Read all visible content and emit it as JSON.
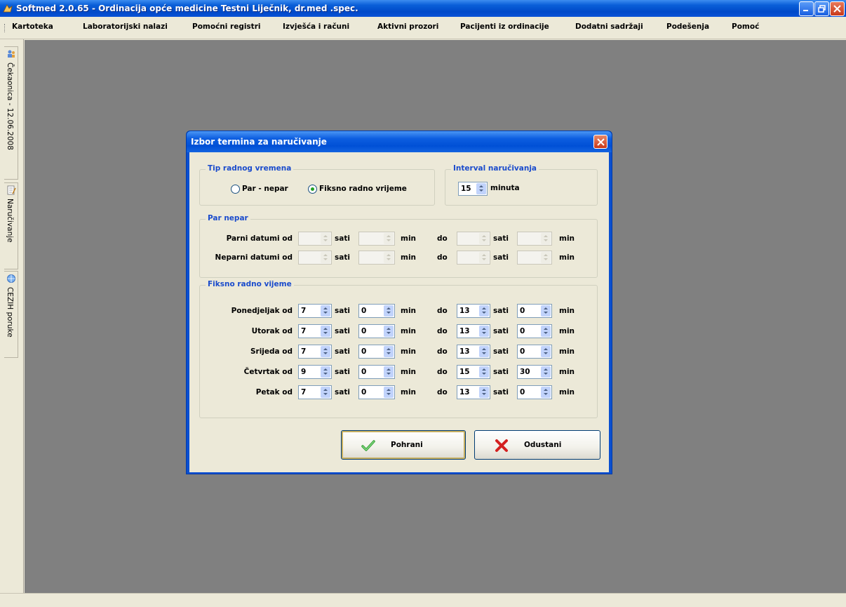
{
  "window": {
    "title": "Softmed 2.0.65 - Ordinacija opće medicine Testni Liječnik, dr.med .spec."
  },
  "menu": [
    "Kartoteka",
    "Laboratorijski nalazi",
    "Pomoćni registri",
    "Izvješća i računi",
    "Aktivni prozori",
    "Pacijenti iz ordinacije",
    "Dodatni sadržaji",
    "Podešenja",
    "Pomoć"
  ],
  "side_tabs": [
    "Čekaonica - 12.06.2008",
    "Naručivanje",
    "CEZIH poruke"
  ],
  "dialog": {
    "title": "Izbor termina za naručivanje",
    "work_type": {
      "legend": "Tip radnog vremena",
      "options": [
        "Par - nepar",
        "Fiksno radno vrijeme"
      ],
      "selected": "Fiksno radno vrijeme"
    },
    "interval": {
      "legend": "Interval naručivanja",
      "value": "15",
      "unit": "minuta"
    },
    "par_nepar": {
      "legend": "Par nepar",
      "rows": [
        {
          "label": "Parni datumi od"
        },
        {
          "label": "Neparni datumi od"
        }
      ]
    },
    "fixed": {
      "legend": "Fiksno radno vijeme",
      "rows": [
        {
          "label": "Ponedjeljak od",
          "from_h": "7",
          "from_m": "0",
          "to_h": "13",
          "to_m": "0"
        },
        {
          "label": "Utorak od",
          "from_h": "7",
          "from_m": "0",
          "to_h": "13",
          "to_m": "0"
        },
        {
          "label": "Srijeda od",
          "from_h": "7",
          "from_m": "0",
          "to_h": "13",
          "to_m": "0"
        },
        {
          "label": "Četvrtak od",
          "from_h": "9",
          "from_m": "0",
          "to_h": "15",
          "to_m": "30"
        },
        {
          "label": "Petak od",
          "from_h": "7",
          "from_m": "0",
          "to_h": "13",
          "to_m": "0"
        }
      ]
    },
    "units": {
      "sati": "sati",
      "min": "min",
      "do": "do"
    },
    "buttons": {
      "save": "Pohrani",
      "cancel": "Odustani"
    }
  }
}
